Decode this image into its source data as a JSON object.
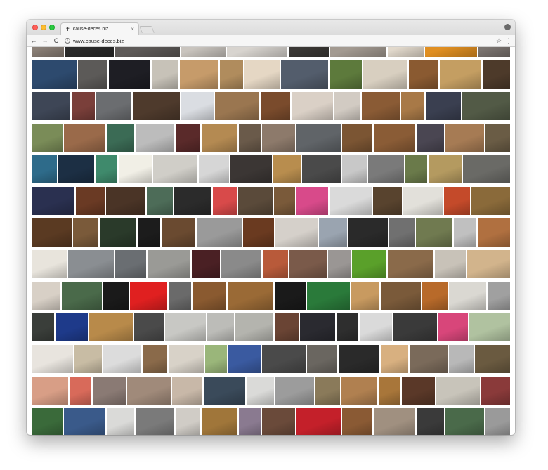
{
  "browser": {
    "tab_title": "cause-deces.biz",
    "tab_favicon": "✝",
    "url": "www.cause-deces.biz",
    "back_glyph": "←",
    "forward_glyph": "→",
    "reload_glyph": "C",
    "info_glyph": "i",
    "star_glyph": "☆",
    "menu_glyph": "⋮",
    "close_glyph": "×"
  },
  "gallery": {
    "rows": [
      {
        "colors": [
          "#8a7f76",
          "#2a2a2a",
          "#5e5a58",
          "#c9c4be",
          "#d8d4cf",
          "#3b3835",
          "#a39a91",
          "#e2d9cc",
          "#e08f22",
          "#7b7470"
        ]
      },
      {
        "colors": [
          "#2d4a6e",
          "#5c5a58",
          "#1e1e24",
          "#c7c2b8",
          "#c69b6a",
          "#b08c5d",
          "#e5d7c4",
          "#535d6c",
          "#5d7a3c",
          "#d8cfc0",
          "#8a5a31",
          "#c49e62",
          "#4d3a2a"
        ]
      },
      {
        "colors": [
          "#3e4656",
          "#7a3f3a",
          "#6b6d70",
          "#4e3a2c",
          "#dadde2",
          "#9a7650",
          "#7a4b2c",
          "#dad0c6",
          "#d2cbc3",
          "#8a5b35",
          "#a87947",
          "#3a3f50",
          "#525a46"
        ]
      },
      {
        "colors": [
          "#7a8c58",
          "#9a6a4a",
          "#3b6b55",
          "#bcbcbc",
          "#5a2a2a",
          "#b48a52",
          "#6a5a4a",
          "#8d7a6b",
          "#606468",
          "#7b5533",
          "#8a5c36",
          "#4a4652",
          "#a67b54",
          "#6a5c45"
        ]
      },
      {
        "colors": [
          "#2e6b8a",
          "#1c2f44",
          "#3f8a6c",
          "#f1efe6",
          "#d0cec8",
          "#d6d6d6",
          "#3b3634",
          "#b88d4e",
          "#4a4a4a",
          "#c8c8c8",
          "#7a7a7a",
          "#6a7a4a",
          "#b49a60",
          "#6a6a66"
        ]
      },
      {
        "colors": [
          "#2a3050",
          "#6a3a24",
          "#4a3426",
          "#4d6c58",
          "#2b2b2b",
          "#d84a4a",
          "#5a4a3a",
          "#7a5a3a",
          "#d84a8a",
          "#dadada",
          "#58432e",
          "#e2e0da",
          "#c44a2a",
          "#8a6a3a"
        ]
      },
      {
        "colors": [
          "#5a3a22",
          "#7a5a3a",
          "#2a3a2a",
          "#1c1c1c",
          "#6a4a30",
          "#9a9a9a",
          "#6a3a20",
          "#d5d0ca",
          "#9aa4b0",
          "#2a2a2a",
          "#707070",
          "#707a50",
          "#c0c0c0",
          "#b07040"
        ]
      },
      {
        "colors": [
          "#e8e4dc",
          "#8a8e92",
          "#6a6e72",
          "#9a9a96",
          "#4a2024",
          "#8a8a8a",
          "#b85a3a",
          "#7a5a4a",
          "#9a9694",
          "#5aa02a",
          "#8a6a4a",
          "#c8c2b8",
          "#d2b48c"
        ]
      },
      {
        "colors": [
          "#d8d0c6",
          "#4a6a4a",
          "#1a1a1a",
          "#e02020",
          "#6a6a6a",
          "#8a5a30",
          "#9a6a36",
          "#1a1a1a",
          "#2a7a3a",
          "#c89a60",
          "#7a5a3a",
          "#b86a2a",
          "#dad8d2",
          "#a0a0a0"
        ]
      },
      {
        "colors": [
          "#3a3e3a",
          "#1e3a8a",
          "#b88a4a",
          "#4a4a4a",
          "#c8c8c4",
          "#bcbcb8",
          "#b4b4ae",
          "#6a4434",
          "#2a2a30",
          "#2e2e2e",
          "#dadada",
          "#3a3a3a",
          "#d8467a",
          "#b0c2a0"
        ]
      },
      {
        "colors": [
          "#e8e4de",
          "#c8bca4",
          "#dcdcdc",
          "#8a6a4a",
          "#d8d2c8",
          "#9ab67a",
          "#3a5aa0",
          "#4a4a4a",
          "#6a6660",
          "#2a2a2a",
          "#d8b080",
          "#7a6a5a",
          "#b8b8b8",
          "#6a5a40"
        ]
      },
      {
        "colors": [
          "#d89e86",
          "#d86a5a",
          "#8a7a74",
          "#a08a7a",
          "#c8b8a8",
          "#3a4a5a",
          "#dadad8",
          "#9c9c9c",
          "#8a7a5a",
          "#b08050",
          "#a8763a",
          "#5a3828",
          "#c8c4ba",
          "#8a3a3a"
        ]
      },
      {
        "colors": [
          "#3a6a3a",
          "#3a5a8a",
          "#dadad8",
          "#7a7a7a",
          "#d0ccc6",
          "#a0763a",
          "#8a7a90",
          "#6a4a3a",
          "#c4202a",
          "#8a5a34",
          "#a09080",
          "#3a3a3a",
          "#4a6a4a",
          "#9a9a9a"
        ]
      }
    ]
  }
}
